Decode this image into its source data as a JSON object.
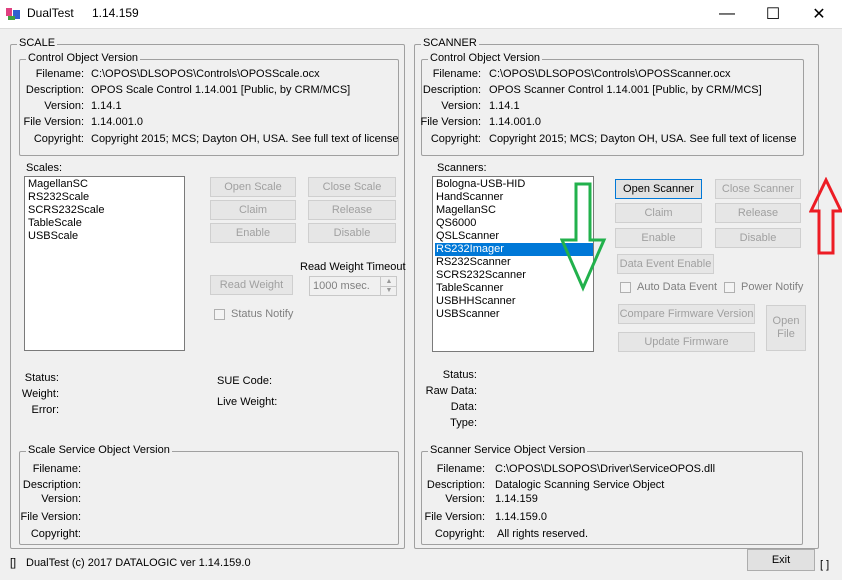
{
  "window": {
    "title": "DualTest",
    "version": "1.14.159",
    "minimize": "—",
    "maximize": "☐",
    "close": "✕"
  },
  "scale": {
    "group_title": "SCALE",
    "control": {
      "title": "Control Object Version",
      "labels": [
        "Filename:",
        "Description:",
        "Version:",
        "File Version:",
        "Copyright:"
      ],
      "values": [
        "C:\\OPOS\\DLSOPOS\\Controls\\OPOSScale.ocx",
        "OPOS Scale Control 1.14.001 [Public, by CRM/MCS]",
        "1.14.1",
        "1.14.001.0",
        "Copyright 2015; MCS; Dayton OH, USA. See full text of license"
      ]
    },
    "list_label": "Scales:",
    "items": [
      "MagellanSC",
      "RS232Scale",
      "SCRS232Scale",
      "TableScale",
      "USBScale"
    ],
    "buttons": {
      "open": "Open Scale",
      "close": "Close Scale",
      "claim": "Claim",
      "release": "Release",
      "enable": "Enable",
      "disable": "Disable",
      "read_weight": "Read Weight"
    },
    "timeout_label": "Read Weight Timeout",
    "timeout_value": "1000 msec.",
    "status_notify": "Status Notify",
    "status_labels": [
      "Status:",
      "Weight:",
      "Error:"
    ],
    "sue_code": "SUE Code:",
    "live_weight": "Live Weight:",
    "service": {
      "title": "Scale Service Object Version",
      "labels": [
        "Filename:",
        "Description:",
        "Version:",
        "File Version:",
        "Copyright:"
      ]
    }
  },
  "scanner": {
    "group_title": "SCANNER",
    "control": {
      "title": "Control Object Version",
      "labels": [
        "Filename:",
        "Description:",
        "Version:",
        "File Version:",
        "Copyright:"
      ],
      "values": [
        "C:\\OPOS\\DLSOPOS\\Controls\\OPOSScanner.ocx",
        "OPOS Scanner Control 1.14.001 [Public, by CRM/MCS]",
        "1.14.1",
        "1.14.001.0",
        "Copyright 2015; MCS; Dayton OH, USA. See full text of license"
      ]
    },
    "list_label": "Scanners:",
    "items": [
      "Bologna-USB-HID",
      "HandScanner",
      "MagellanSC",
      "QS6000",
      "QSLScanner",
      "RS232Imager",
      "RS232Scanner",
      "SCRS232Scanner",
      "TableScanner",
      "USBHHScanner",
      "USBScanner"
    ],
    "selected_item": "RS232Imager",
    "buttons": {
      "open": "Open Scanner",
      "close": "Close Scanner",
      "claim": "Claim",
      "release": "Release",
      "enable": "Enable",
      "disable": "Disable",
      "data_event_enable": "Data Event Enable",
      "compare_firmware": "Compare Firmware Version",
      "update_firmware": "Update Firmware",
      "open_file": "Open File"
    },
    "auto_data_event": "Auto Data Event",
    "power_notify": "Power Notify",
    "status_labels": [
      "Status:",
      "Raw Data:",
      "Data:",
      "Type:"
    ],
    "service": {
      "title": "Scanner Service Object Version",
      "labels": [
        "Filename:",
        "Description:",
        "Version:",
        "File Version:",
        "Copyright:"
      ],
      "values": [
        "C:\\OPOS\\DLSOPOS\\Driver\\ServiceOPOS.dll",
        "Datalogic Scanning Service Object",
        "1.14.159",
        "1.14.159.0",
        "All rights reserved."
      ]
    }
  },
  "footer": {
    "left_bracket": "[]",
    "text": "DualTest (c) 2017 DATALOGIC ver 1.14.159.0",
    "exit": "Exit",
    "right_bracket": "[ ]"
  },
  "annotations": {
    "green_arrow_color": "#22b14c",
    "red_arrow_color": "#ed1c24"
  }
}
